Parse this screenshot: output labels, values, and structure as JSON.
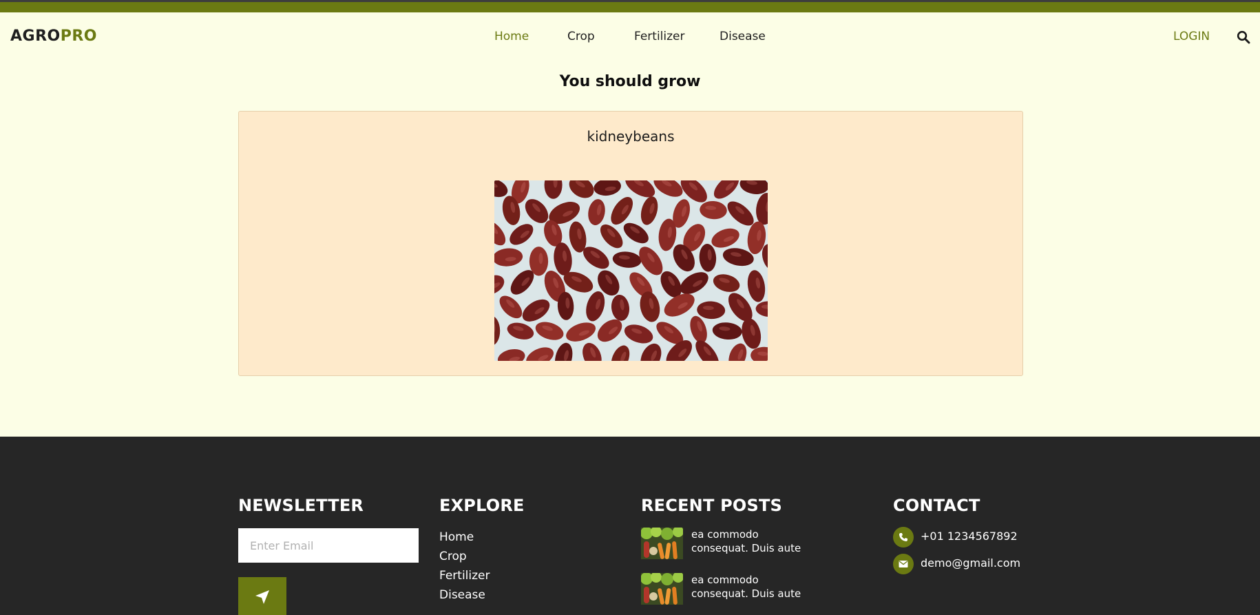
{
  "brand": {
    "part1": "AGRO",
    "part2": "PRO"
  },
  "nav": [
    {
      "label": "Home",
      "active": true
    },
    {
      "label": "Crop",
      "active": false
    },
    {
      "label": "Fertilizer",
      "active": false
    },
    {
      "label": "Disease",
      "active": false
    }
  ],
  "header": {
    "login_label": "LOGIN",
    "search_icon": "search-icon"
  },
  "result": {
    "heading": "You should grow",
    "crop_name": "kidneybeans",
    "image": "kidney-beans-photo"
  },
  "footer": {
    "newsletter": {
      "title": "NEWSLETTER",
      "email_placeholder": "Enter Email",
      "send_icon": "paper-plane-icon"
    },
    "explore": {
      "title": "EXPLORE",
      "links": [
        "Home",
        "Crop",
        "Fertilizer",
        "Disease"
      ]
    },
    "recent_posts": {
      "title": "RECENT POSTS",
      "posts": [
        {
          "line1": "ea commodo",
          "line2": "consequat. Duis aute",
          "thumb": "vegetables-thumbnail"
        },
        {
          "line1": "ea commodo",
          "line2": "consequat. Duis aute",
          "thumb": "vegetables-thumbnail"
        }
      ]
    },
    "contact": {
      "title": "CONTACT",
      "phone": "+01 1234567892",
      "email": "demo@gmail.com"
    }
  },
  "colors": {
    "accent": "#6b7a12",
    "page_bg": "#fcfee6",
    "card_bg": "#feeacb",
    "footer_bg": "#262626"
  }
}
